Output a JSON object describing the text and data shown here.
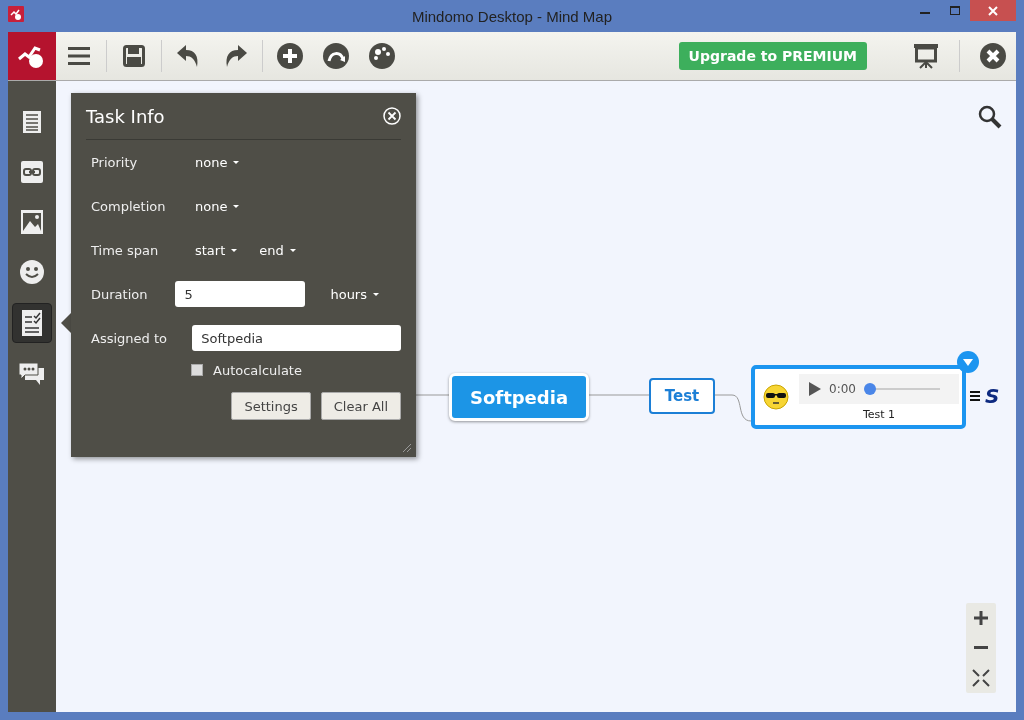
{
  "window": {
    "title": "Mindomo Desktop - Mind Map"
  },
  "toolbar": {
    "upgrade_button": "Upgrade to PREMIUM"
  },
  "sidebar": {
    "items": [
      {
        "kind": "outline",
        "selected": false
      },
      {
        "kind": "link",
        "selected": false
      },
      {
        "kind": "image",
        "selected": false
      },
      {
        "kind": "smiley",
        "selected": false
      },
      {
        "kind": "task",
        "selected": true
      },
      {
        "kind": "comment",
        "selected": false
      }
    ]
  },
  "task_info": {
    "title": "Task Info",
    "rows": [
      {
        "label": "Priority",
        "value": "none"
      },
      {
        "label": "Completion",
        "value": "none"
      }
    ],
    "time_span": {
      "label": "Time span",
      "start": "start",
      "end": "end"
    },
    "duration": {
      "label": "Duration",
      "value": "5",
      "unit": "hours"
    },
    "assigned": {
      "label": "Assigned to",
      "value": "Softpedia"
    },
    "autocalculate": {
      "label": "Autocalculate",
      "checked": false
    },
    "buttons": [
      "Settings",
      "Clear All"
    ]
  },
  "map": {
    "central": "Softpedia",
    "child": "Test",
    "audio_node": {
      "time": "0:00",
      "level": 0.0,
      "caption": "Test 1",
      "trailing": "S"
    }
  }
}
